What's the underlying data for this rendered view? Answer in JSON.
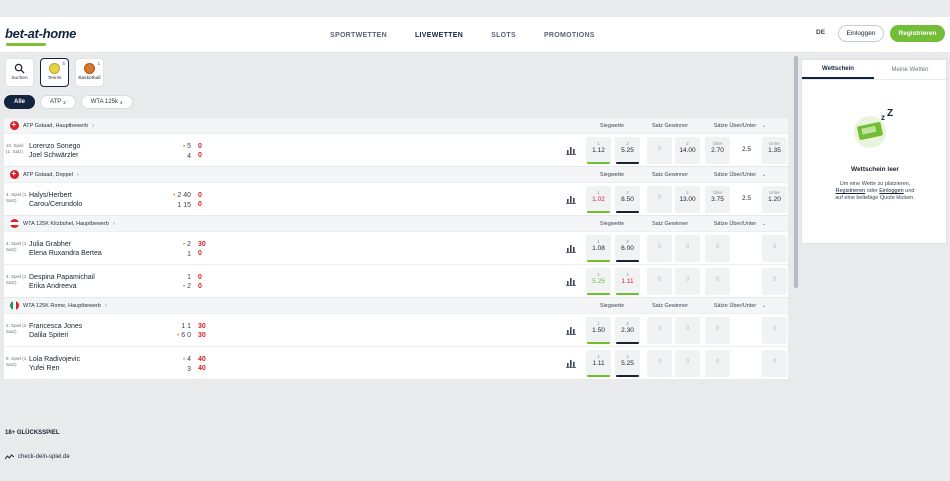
{
  "brand": {
    "logo": "bet-at-home",
    "accent": "#72be37",
    "navy": "#14243f",
    "live_red": "#d6202a"
  },
  "nav": {
    "items": [
      "SPORTWETTEN",
      "LIVEWETTEN",
      "SLOTS",
      "PROMOTIONS"
    ],
    "active": "LIVEWETTEN"
  },
  "header": {
    "lang": "DE",
    "login": "Einloggen",
    "register": "Registrieren"
  },
  "sports": [
    {
      "label": "Suchen",
      "icon": "search-icon",
      "count": ""
    },
    {
      "label": "Tennis",
      "icon": "tennis-ball-icon",
      "count": "5"
    },
    {
      "label": "Basketball",
      "icon": "basketball-icon",
      "count": "1"
    }
  ],
  "filters": [
    {
      "label": "Alle",
      "count": ""
    },
    {
      "label": "ATP",
      "count": "2"
    },
    {
      "label": "WTA 125k",
      "count": "4"
    }
  ],
  "markets": {
    "m1": "Siegwette",
    "m2": "Satz Gewinner",
    "m3": "Sätze Über/Unter",
    "chevron": "⌄"
  },
  "groups": [
    {
      "title": "ATP Gstaad, Hauptbewerb",
      "flag": "ch",
      "events": [
        {
          "info1": "10. Spiel",
          "info2": "(1. Satz)",
          "p1": "Lorenzo Sonego",
          "p2": "Joel Schwärzler",
          "g1": "5",
          "g2": "4",
          "srv": 1,
          "pts1": "0",
          "pts2": "0",
          "odds": [
            {
              "l": "1",
              "v": "1.12",
              "bar": "g",
              "state": ""
            },
            {
              "l": "2",
              "v": "5.25",
              "bar": "k",
              "state": ""
            },
            {
              "l": "1",
              "v": "0",
              "bar": "",
              "state": "empty"
            },
            {
              "l": "2",
              "v": "14.00",
              "bar": "",
              "state": ""
            },
            {
              "l": "Über",
              "v": "2.70",
              "bar": "",
              "state": ""
            },
            {
              "l": "Unter",
              "v": "1.35",
              "bar": "",
              "state": ""
            }
          ],
          "line": "2.5"
        }
      ]
    },
    {
      "title": "ATP Gstaad, Doppel",
      "flag": "ch",
      "events": [
        {
          "info1": "4. Spiel (1.",
          "info2": "Satz)",
          "p1": "Halys/Herbert",
          "p2": "Carou/Cerundolo",
          "g1": "2 40",
          "g2": "1 15",
          "srv": 1,
          "pts1": "0",
          "pts2": "0",
          "odds": [
            {
              "l": "1",
              "v": "1.02",
              "bar": "g",
              "state": "red"
            },
            {
              "l": "2",
              "v": "8.50",
              "bar": "k",
              "state": ""
            },
            {
              "l": "1",
              "v": "0",
              "bar": "",
              "state": "empty"
            },
            {
              "l": "2",
              "v": "13.00",
              "bar": "",
              "state": ""
            },
            {
              "l": "Über",
              "v": "3.75",
              "bar": "",
              "state": ""
            },
            {
              "l": "Unter",
              "v": "1.20",
              "bar": "",
              "state": ""
            }
          ],
          "line": "2.5"
        }
      ]
    },
    {
      "title": "WTA 125K Kitzbühel, Hauptbewerb",
      "flag": "at",
      "events": [
        {
          "info1": "4. Spiel (1.",
          "info2": "Satz)",
          "p1": "Julia Grabher",
          "p2": "Elena Ruxandra Bertea",
          "g1": "2",
          "g2": "1",
          "srv": 1,
          "pts1": "30",
          "pts2": "0",
          "odds": [
            {
              "l": "1",
              "v": "1.08",
              "bar": "g",
              "state": ""
            },
            {
              "l": "2",
              "v": "6.00",
              "bar": "k",
              "state": ""
            },
            {
              "l": "",
              "v": "0",
              "bar": "",
              "state": "empty"
            },
            {
              "l": "",
              "v": "0",
              "bar": "",
              "state": "empty"
            },
            {
              "l": "",
              "v": "0",
              "bar": "",
              "state": "empty"
            },
            {
              "l": "",
              "v": "0",
              "bar": "",
              "state": "empty"
            }
          ],
          "line": ""
        },
        {
          "info1": "4. Spiel (1.",
          "info2": "Satz)",
          "p1": "Despina Papamichail",
          "p2": "Erika Andreeva",
          "g1": "1",
          "g2": "2",
          "srv": 2,
          "pts1": "0",
          "pts2": "0",
          "odds": [
            {
              "l": "1",
              "v": "5.25",
              "bar": "g",
              "state": "green"
            },
            {
              "l": "2",
              "v": "1.11",
              "bar": "g",
              "state": "red"
            },
            {
              "l": "",
              "v": "0",
              "bar": "",
              "state": "empty"
            },
            {
              "l": "",
              "v": "0",
              "bar": "",
              "state": "empty"
            },
            {
              "l": "",
              "v": "0",
              "bar": "",
              "state": "empty"
            },
            {
              "l": "",
              "v": "0",
              "bar": "",
              "state": "empty"
            }
          ],
          "line": ""
        }
      ]
    },
    {
      "title": "WTA 125K Rome, Hauptbewerb",
      "flag": "it",
      "events": [
        {
          "info1": "2. Spiel (2.",
          "info2": "Satz)",
          "p1": "Francesca Jones",
          "p2": "Dalila Spiteri",
          "g1": "1 1",
          "g2": "6 0",
          "srv": 2,
          "pts1": "30",
          "pts2": "30",
          "odds": [
            {
              "l": "1",
              "v": "1.50",
              "bar": "g",
              "state": ""
            },
            {
              "l": "2",
              "v": "2.30",
              "bar": "k",
              "state": ""
            },
            {
              "l": "",
              "v": "0",
              "bar": "",
              "state": "empty"
            },
            {
              "l": "",
              "v": "0",
              "bar": "",
              "state": "empty"
            },
            {
              "l": "",
              "v": "0",
              "bar": "",
              "state": "empty"
            },
            {
              "l": "",
              "v": "0",
              "bar": "",
              "state": "empty"
            }
          ],
          "line": ""
        },
        {
          "info1": "8. Spiel (1.",
          "info2": "Satz)",
          "p1": "Lola Radivojevic",
          "p2": "Yufei Ren",
          "g1": "4",
          "g2": "3",
          "srv": 1,
          "pts1": "40",
          "pts2": "40",
          "odds": [
            {
              "l": "1",
              "v": "1.11",
              "bar": "g",
              "state": ""
            },
            {
              "l": "2",
              "v": "5.25",
              "bar": "k",
              "state": ""
            },
            {
              "l": "",
              "v": "0",
              "bar": "",
              "state": "empty"
            },
            {
              "l": "",
              "v": "0",
              "bar": "",
              "state": "empty"
            },
            {
              "l": "",
              "v": "0",
              "bar": "",
              "state": "empty"
            },
            {
              "l": "",
              "v": "0",
              "bar": "",
              "state": "empty"
            }
          ],
          "line": ""
        }
      ]
    }
  ],
  "betslip": {
    "tab1": "Wettschein",
    "tab2": "Meine Wetten",
    "title": "Wettschein leer",
    "text1": "Um eine Wette zu platzieren,",
    "link1": "Registrieren",
    "text2": "oder",
    "link2": "Einloggen",
    "text3": "und auf eine beliebige Quote klicken."
  },
  "footer": {
    "age": "18+ GLÜCKSSPIEL",
    "link": "check-dein-spiel.de"
  }
}
